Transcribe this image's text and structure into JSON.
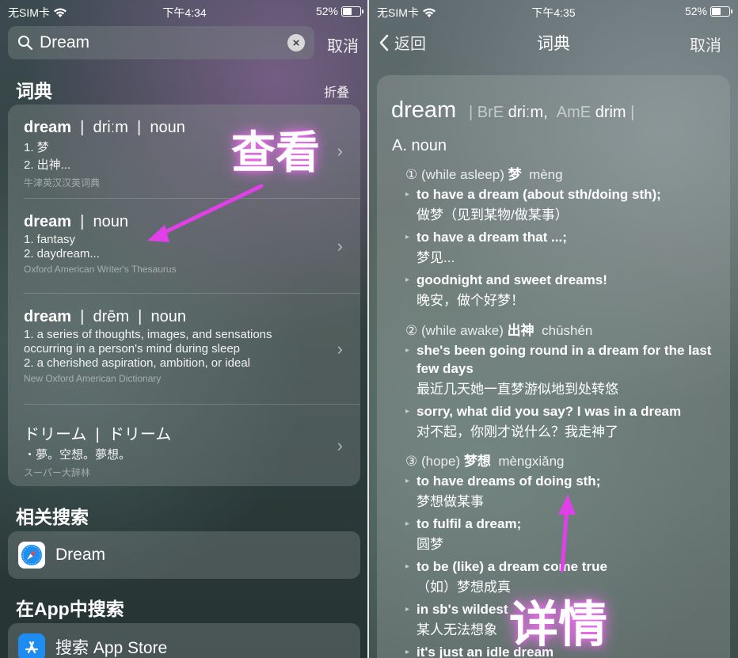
{
  "left_panel": {
    "status": {
      "carrier": "无SIM卡",
      "time": "下午4:34",
      "battery": "52%",
      "battery_level": 0.52
    },
    "search": {
      "query": "Dream",
      "clear_icon": "×",
      "cancel": "取消"
    },
    "dictionary_section": {
      "title": "词典",
      "collapse": "折叠"
    },
    "entries": [
      {
        "word": "dream",
        "pron": "driːm",
        "pos": "noun",
        "lines": [
          "1. 梦",
          "2. 出神..."
        ],
        "source": "牛津英汉汉英词典"
      },
      {
        "word": "dream",
        "pron": "",
        "pos": "noun",
        "lines": [
          "1. fantasy",
          "2. daydream..."
        ],
        "source": "Oxford American Writer's Thesaurus"
      },
      {
        "word": "dream",
        "pron": "drēm",
        "pos": "noun",
        "lines": [
          "1. a series of thoughts, images, and sensations",
          "occurring in a person's mind during sleep",
          "2. a cherished aspiration, ambition, or ideal"
        ],
        "source": "New Oxford American Dictionary"
      },
      {
        "word": "ドリーム",
        "pron": "",
        "pos": "ドリーム",
        "lines": [
          "・夢。空想。夢想。"
        ],
        "source": "スーパー大辞林"
      }
    ],
    "related_section": {
      "title": "相关搜索",
      "item": "Dream"
    },
    "appstore_section": {
      "title": "在App中搜索",
      "item": "搜索 App Store"
    },
    "annotation": "查看"
  },
  "right_panel": {
    "status": {
      "carrier": "无SIM卡",
      "time": "下午4:35",
      "battery": "52%",
      "battery_level": 0.52
    },
    "nav": {
      "back": "返回",
      "title": "词典",
      "cancel": "取消"
    },
    "headword": "dream",
    "phonetics": {
      "bre_label": "BrE",
      "bre": "driːm,",
      "ame_label": "AmE",
      "ame": "drim"
    },
    "pos": "A.  noun",
    "senses": [
      {
        "num": "①",
        "gloss": "(while asleep)",
        "zh": "梦",
        "pinyin": "mèng"
      },
      {
        "num": "②",
        "gloss": "(while awake)",
        "zh": "出神",
        "pinyin": "chūshén"
      },
      {
        "num": "③",
        "gloss": "(hope)",
        "zh": "梦想",
        "pinyin": "mèngxiǎng"
      }
    ],
    "examples": [
      {
        "en": "to have a dream (about sth/doing sth);",
        "zh": "做梦（见到某物/做某事）"
      },
      {
        "en": "to have a dream that ...;",
        "zh": "梦见..."
      },
      {
        "en": "goodnight and sweet dreams!",
        "zh": "晚安，做个好梦！"
      },
      {
        "en": "she's been going round in a dream for the last few days",
        "zh": "最近几天她一直梦游似地到处转悠"
      },
      {
        "en": "sorry, what did you say? I was in a dream",
        "zh": "对不起，你刚才说什么？我走神了"
      },
      {
        "en": "to have dreams of doing sth;",
        "zh": "梦想做某事"
      },
      {
        "en": "to fulfil a dream;",
        "zh": "圆梦"
      },
      {
        "en": "to be (like) a dream come true",
        "zh": "（如）梦想成真"
      },
      {
        "en": "in sb's wildest",
        "zh": "某人无法想象"
      },
      {
        "en": "it's just an idle dream",
        "zh": ""
      }
    ],
    "annotation": "详情"
  },
  "colors": {
    "annotation_glow": "#ff66ff",
    "arrow": "#e040e8"
  }
}
